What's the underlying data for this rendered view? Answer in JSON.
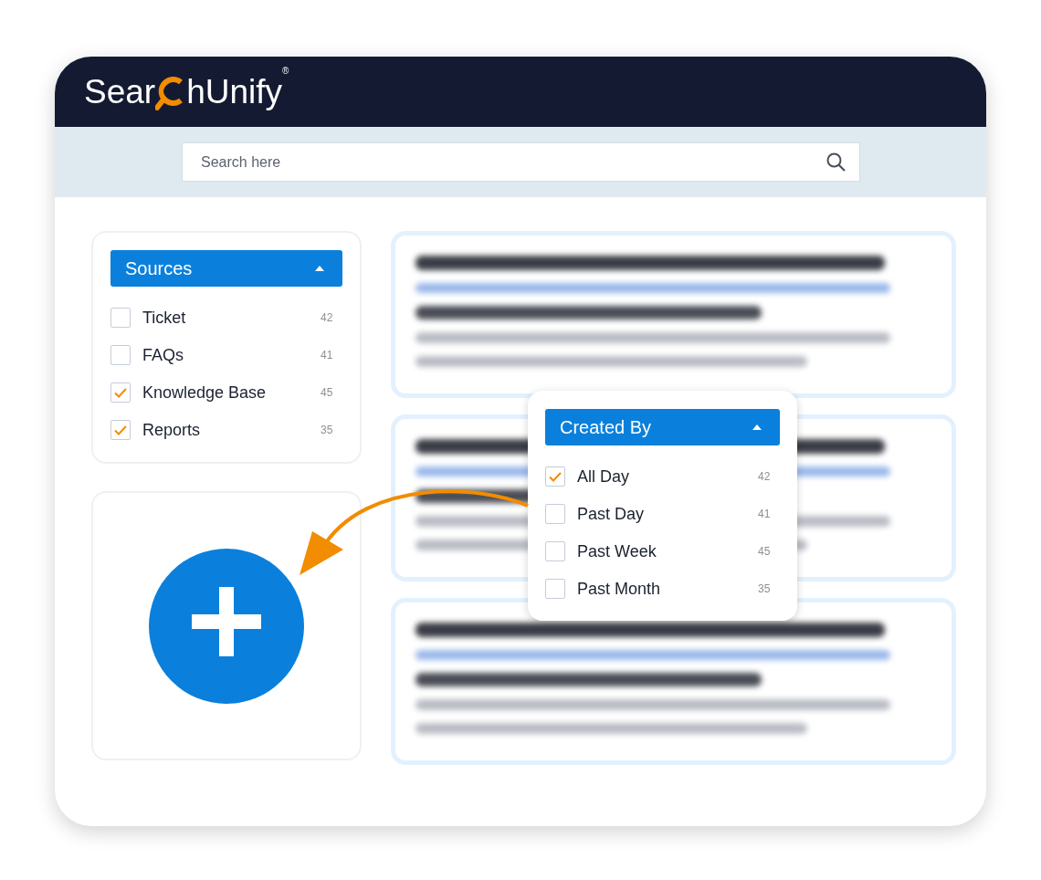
{
  "logo": {
    "text_before": "Sear",
    "text_after": "hUnify",
    "registered_mark": "®"
  },
  "search": {
    "placeholder": "Search here"
  },
  "sources_facet": {
    "title": "Sources",
    "expanded": true,
    "options": [
      {
        "label": "Ticket",
        "count": "42",
        "checked": false
      },
      {
        "label": "FAQs",
        "count": "41",
        "checked": false
      },
      {
        "label": "Knowledge Base",
        "count": "45",
        "checked": true
      },
      {
        "label": "Reports",
        "count": "35",
        "checked": true
      }
    ]
  },
  "created_by_popup": {
    "title": "Created By",
    "expanded": true,
    "options": [
      {
        "label": "All Day",
        "count": "42",
        "checked": true
      },
      {
        "label": "Past Day",
        "count": "41",
        "checked": false
      },
      {
        "label": "Past Week",
        "count": "45",
        "checked": false
      },
      {
        "label": "Past Month",
        "count": "35",
        "checked": false
      }
    ]
  },
  "results": [
    {
      "kind": "blurred"
    },
    {
      "kind": "blurred"
    },
    {
      "kind": "blurred"
    }
  ]
}
